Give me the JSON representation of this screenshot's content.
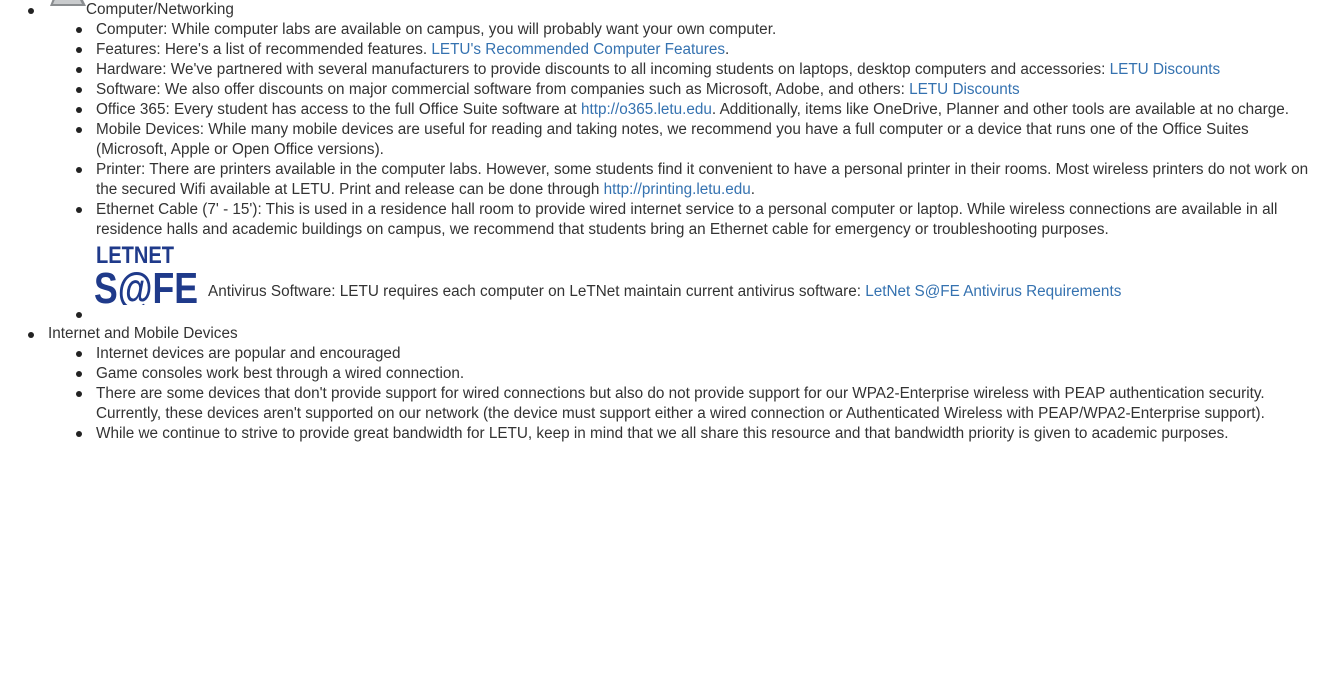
{
  "colors": {
    "link": "#3572b0",
    "text": "#333333",
    "logo": "#1f3a8a"
  },
  "sections": [
    {
      "title": "Computer/Networking",
      "icon": "laptop-icon",
      "items": [
        {
          "text": "Computer: While computer labs are available on campus, you will probably want your own computer."
        },
        {
          "pre": "Features: Here's a list of recommended features. ",
          "link": "LETU's Recommended Computer Features",
          "post": "."
        },
        {
          "pre": "Hardware: We've partnered with several manufacturers to provide discounts to all incoming students on laptops, desktop computers and accessories: ",
          "link": "LETU Discounts",
          "post": ""
        },
        {
          "pre": "Software: We also offer discounts on major commercial software from companies such as Microsoft, Adobe, and others: ",
          "link": "LETU Discounts",
          "post": ""
        },
        {
          "pre": "Office 365: Every student has access to the full Office Suite software at ",
          "link": "http://o365.letu.edu",
          "post": ". Additionally, items like OneDrive, Planner and other tools are available at no charge."
        },
        {
          "text": "Mobile Devices: While many mobile devices are useful for reading and taking notes, we recommend you have a full computer or a device that runs one of the Office Suites (Microsoft, Apple or Open Office versions)."
        },
        {
          "pre": "Printer: There are printers available in the computer labs. However, some students find it convenient to have a personal printer in their rooms. Most wireless printers do not work on the secured Wifi available at LETU. Print and release can be done through ",
          "link": "http://printing.letu.edu",
          "post": "."
        },
        {
          "text": "Ethernet Cable (7' - 15'): This is used in a residence hall room to provide wired internet service to a personal computer or laptop. While wireless connections are available in all residence halls and academic buildings on campus, we recommend that students bring an Ethernet cable for emergency or troubleshooting purposes."
        },
        {
          "logo_top": "LETNET",
          "logo_bottom": "S@FE",
          "pre": " Antivirus Software: LETU requires each computer on LeTNet maintain current antivirus software: ",
          "link": "LetNet S@FE Antivirus Requirements",
          "post": ""
        }
      ]
    },
    {
      "title": "Internet and Mobile Devices",
      "items": [
        {
          "text": "Internet devices are popular and encouraged"
        },
        {
          "text": "Game consoles work best through a wired connection."
        },
        {
          "text": "There are some devices that don't provide support for wired connections but also do not provide support for our WPA2-Enterprise wireless with PEAP authentication security. Currently, these devices aren't supported on our network (the device must support either a wired connection or Authenticated Wireless with PEAP/WPA2-Enterprise support)."
        },
        {
          "text": "While we continue to strive to provide great bandwidth for LETU, keep in mind that we all share this resource and that bandwidth priority is given to academic purposes."
        }
      ]
    }
  ]
}
